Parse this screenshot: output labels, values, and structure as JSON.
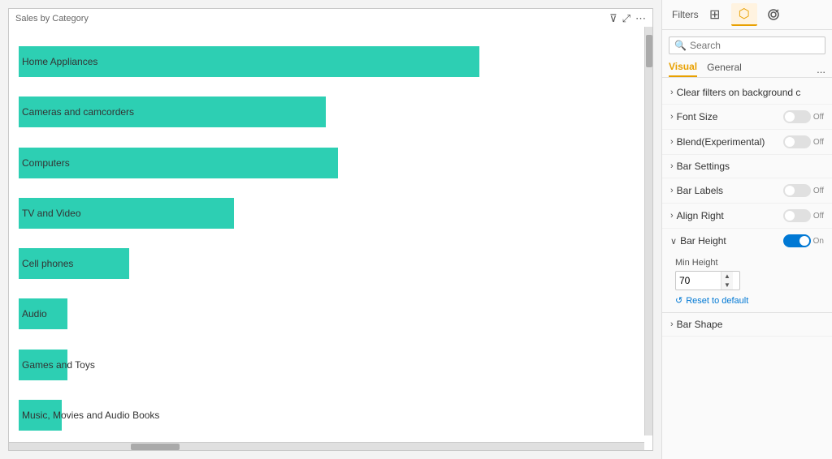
{
  "chart": {
    "title": "Sales by Category",
    "bars": [
      {
        "label": "Home Appliances",
        "width_pct": 75
      },
      {
        "label": "Cameras and camcorders",
        "width_pct": 50
      },
      {
        "label": "Computers",
        "width_pct": 52
      },
      {
        "label": "TV and Video",
        "width_pct": 35
      },
      {
        "label": "Cell phones",
        "width_pct": 18
      },
      {
        "label": "Audio",
        "width_pct": 8
      },
      {
        "label": "Games and Toys",
        "width_pct": 8
      },
      {
        "label": "Music, Movies and Audio Books",
        "width_pct": 7
      }
    ],
    "bar_color": "#2DCFB3"
  },
  "toolbar_icons": {
    "filter": "⊽",
    "expand": "⤢",
    "more": "⋯"
  },
  "format_panel": {
    "filters_label": "Filters",
    "tabs": [
      {
        "label": "⊞",
        "icon_name": "table-icon",
        "active": false
      },
      {
        "label": "⬡",
        "icon_name": "format-icon",
        "active": true
      },
      {
        "label": "🔍",
        "icon_name": "analytics-icon",
        "active": false
      }
    ],
    "search_placeholder": "Search",
    "visual_tab": "Visual",
    "general_tab": "General",
    "more_label": "...",
    "options": [
      {
        "id": "clear-filters",
        "label": "Clear filters on background c",
        "has_toggle": false,
        "toggle_on": false,
        "expanded": false
      },
      {
        "id": "font-size",
        "label": "Font Size",
        "has_toggle": true,
        "toggle_on": false,
        "toggle_text": "Off",
        "expanded": false
      },
      {
        "id": "blend",
        "label": "Blend(Experimental)",
        "has_toggle": true,
        "toggle_on": false,
        "toggle_text": "Off",
        "expanded": false
      },
      {
        "id": "bar-settings",
        "label": "Bar Settings",
        "has_toggle": false,
        "toggle_on": false,
        "expanded": false
      },
      {
        "id": "bar-labels",
        "label": "Bar Labels",
        "has_toggle": true,
        "toggle_on": false,
        "toggle_text": "Off",
        "expanded": false
      },
      {
        "id": "align-right",
        "label": "Align Right",
        "has_toggle": true,
        "toggle_on": false,
        "toggle_text": "Off",
        "expanded": false
      }
    ],
    "bar_height": {
      "section_label": "Bar Height",
      "toggle_on": true,
      "toggle_text": "On",
      "min_height_label": "Min Height",
      "min_height_value": "70",
      "reset_label": "Reset to default"
    },
    "bar_shape": {
      "label": "Bar Shape",
      "has_toggle": false
    }
  }
}
